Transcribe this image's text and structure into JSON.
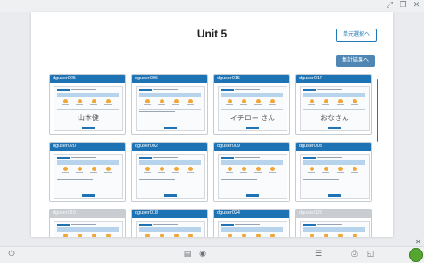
{
  "window": {
    "icons": [
      "expand-icon",
      "restore-icon",
      "close-icon"
    ]
  },
  "header": {
    "title": "Unit 5",
    "back_label": "単元選択へ",
    "results_label": "集計結果へ"
  },
  "cards": [
    {
      "user": "dguser025",
      "handwriting": "山本健",
      "muted": false
    },
    {
      "user": "dguser006",
      "handwriting": "",
      "muted": false
    },
    {
      "user": "dguser015",
      "handwriting": "イチロー さん",
      "muted": false
    },
    {
      "user": "dguser017",
      "handwriting": "おなさん",
      "muted": false
    },
    {
      "user": "dguser020",
      "handwriting": "",
      "muted": false
    },
    {
      "user": "dguser002",
      "handwriting": "",
      "muted": false
    },
    {
      "user": "dguser009",
      "handwriting": "",
      "muted": false
    },
    {
      "user": "dguser003",
      "handwriting": "",
      "muted": false
    },
    {
      "user": "dguser019",
      "handwriting": "",
      "muted": true
    },
    {
      "user": "dguser018",
      "handwriting": "",
      "muted": false
    },
    {
      "user": "dguser024",
      "handwriting": "",
      "muted": false
    },
    {
      "user": "dguser023",
      "handwriting": "",
      "muted": true
    }
  ],
  "colors": {
    "accent": "#1e73b4",
    "muted_header": "#c9cdd2"
  }
}
